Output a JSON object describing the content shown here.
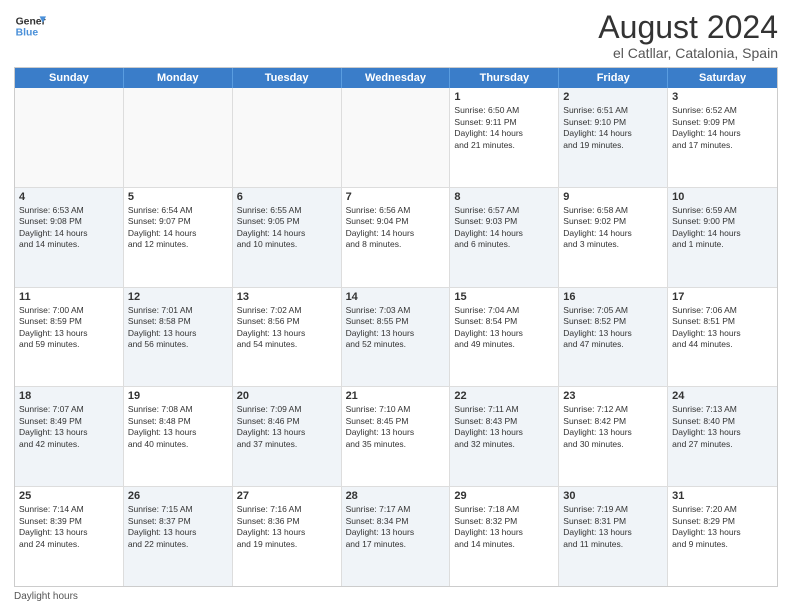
{
  "header": {
    "logo_line1": "General",
    "logo_line2": "Blue",
    "main_title": "August 2024",
    "subtitle": "el Catllar, Catalonia, Spain"
  },
  "calendar": {
    "days_of_week": [
      "Sunday",
      "Monday",
      "Tuesday",
      "Wednesday",
      "Thursday",
      "Friday",
      "Saturday"
    ],
    "weeks": [
      [
        {
          "day": "",
          "empty": true,
          "shaded": false,
          "lines": []
        },
        {
          "day": "",
          "empty": true,
          "shaded": false,
          "lines": []
        },
        {
          "day": "",
          "empty": true,
          "shaded": false,
          "lines": []
        },
        {
          "day": "",
          "empty": true,
          "shaded": false,
          "lines": []
        },
        {
          "day": "1",
          "empty": false,
          "shaded": false,
          "lines": [
            "Sunrise: 6:50 AM",
            "Sunset: 9:11 PM",
            "Daylight: 14 hours",
            "and 21 minutes."
          ]
        },
        {
          "day": "2",
          "empty": false,
          "shaded": true,
          "lines": [
            "Sunrise: 6:51 AM",
            "Sunset: 9:10 PM",
            "Daylight: 14 hours",
            "and 19 minutes."
          ]
        },
        {
          "day": "3",
          "empty": false,
          "shaded": false,
          "lines": [
            "Sunrise: 6:52 AM",
            "Sunset: 9:09 PM",
            "Daylight: 14 hours",
            "and 17 minutes."
          ]
        }
      ],
      [
        {
          "day": "4",
          "empty": false,
          "shaded": true,
          "lines": [
            "Sunrise: 6:53 AM",
            "Sunset: 9:08 PM",
            "Daylight: 14 hours",
            "and 14 minutes."
          ]
        },
        {
          "day": "5",
          "empty": false,
          "shaded": false,
          "lines": [
            "Sunrise: 6:54 AM",
            "Sunset: 9:07 PM",
            "Daylight: 14 hours",
            "and 12 minutes."
          ]
        },
        {
          "day": "6",
          "empty": false,
          "shaded": true,
          "lines": [
            "Sunrise: 6:55 AM",
            "Sunset: 9:05 PM",
            "Daylight: 14 hours",
            "and 10 minutes."
          ]
        },
        {
          "day": "7",
          "empty": false,
          "shaded": false,
          "lines": [
            "Sunrise: 6:56 AM",
            "Sunset: 9:04 PM",
            "Daylight: 14 hours",
            "and 8 minutes."
          ]
        },
        {
          "day": "8",
          "empty": false,
          "shaded": true,
          "lines": [
            "Sunrise: 6:57 AM",
            "Sunset: 9:03 PM",
            "Daylight: 14 hours",
            "and 6 minutes."
          ]
        },
        {
          "day": "9",
          "empty": false,
          "shaded": false,
          "lines": [
            "Sunrise: 6:58 AM",
            "Sunset: 9:02 PM",
            "Daylight: 14 hours",
            "and 3 minutes."
          ]
        },
        {
          "day": "10",
          "empty": false,
          "shaded": true,
          "lines": [
            "Sunrise: 6:59 AM",
            "Sunset: 9:00 PM",
            "Daylight: 14 hours",
            "and 1 minute."
          ]
        }
      ],
      [
        {
          "day": "11",
          "empty": false,
          "shaded": false,
          "lines": [
            "Sunrise: 7:00 AM",
            "Sunset: 8:59 PM",
            "Daylight: 13 hours",
            "and 59 minutes."
          ]
        },
        {
          "day": "12",
          "empty": false,
          "shaded": true,
          "lines": [
            "Sunrise: 7:01 AM",
            "Sunset: 8:58 PM",
            "Daylight: 13 hours",
            "and 56 minutes."
          ]
        },
        {
          "day": "13",
          "empty": false,
          "shaded": false,
          "lines": [
            "Sunrise: 7:02 AM",
            "Sunset: 8:56 PM",
            "Daylight: 13 hours",
            "and 54 minutes."
          ]
        },
        {
          "day": "14",
          "empty": false,
          "shaded": true,
          "lines": [
            "Sunrise: 7:03 AM",
            "Sunset: 8:55 PM",
            "Daylight: 13 hours",
            "and 52 minutes."
          ]
        },
        {
          "day": "15",
          "empty": false,
          "shaded": false,
          "lines": [
            "Sunrise: 7:04 AM",
            "Sunset: 8:54 PM",
            "Daylight: 13 hours",
            "and 49 minutes."
          ]
        },
        {
          "day": "16",
          "empty": false,
          "shaded": true,
          "lines": [
            "Sunrise: 7:05 AM",
            "Sunset: 8:52 PM",
            "Daylight: 13 hours",
            "and 47 minutes."
          ]
        },
        {
          "day": "17",
          "empty": false,
          "shaded": false,
          "lines": [
            "Sunrise: 7:06 AM",
            "Sunset: 8:51 PM",
            "Daylight: 13 hours",
            "and 44 minutes."
          ]
        }
      ],
      [
        {
          "day": "18",
          "empty": false,
          "shaded": true,
          "lines": [
            "Sunrise: 7:07 AM",
            "Sunset: 8:49 PM",
            "Daylight: 13 hours",
            "and 42 minutes."
          ]
        },
        {
          "day": "19",
          "empty": false,
          "shaded": false,
          "lines": [
            "Sunrise: 7:08 AM",
            "Sunset: 8:48 PM",
            "Daylight: 13 hours",
            "and 40 minutes."
          ]
        },
        {
          "day": "20",
          "empty": false,
          "shaded": true,
          "lines": [
            "Sunrise: 7:09 AM",
            "Sunset: 8:46 PM",
            "Daylight: 13 hours",
            "and 37 minutes."
          ]
        },
        {
          "day": "21",
          "empty": false,
          "shaded": false,
          "lines": [
            "Sunrise: 7:10 AM",
            "Sunset: 8:45 PM",
            "Daylight: 13 hours",
            "and 35 minutes."
          ]
        },
        {
          "day": "22",
          "empty": false,
          "shaded": true,
          "lines": [
            "Sunrise: 7:11 AM",
            "Sunset: 8:43 PM",
            "Daylight: 13 hours",
            "and 32 minutes."
          ]
        },
        {
          "day": "23",
          "empty": false,
          "shaded": false,
          "lines": [
            "Sunrise: 7:12 AM",
            "Sunset: 8:42 PM",
            "Daylight: 13 hours",
            "and 30 minutes."
          ]
        },
        {
          "day": "24",
          "empty": false,
          "shaded": true,
          "lines": [
            "Sunrise: 7:13 AM",
            "Sunset: 8:40 PM",
            "Daylight: 13 hours",
            "and 27 minutes."
          ]
        }
      ],
      [
        {
          "day": "25",
          "empty": false,
          "shaded": false,
          "lines": [
            "Sunrise: 7:14 AM",
            "Sunset: 8:39 PM",
            "Daylight: 13 hours",
            "and 24 minutes."
          ]
        },
        {
          "day": "26",
          "empty": false,
          "shaded": true,
          "lines": [
            "Sunrise: 7:15 AM",
            "Sunset: 8:37 PM",
            "Daylight: 13 hours",
            "and 22 minutes."
          ]
        },
        {
          "day": "27",
          "empty": false,
          "shaded": false,
          "lines": [
            "Sunrise: 7:16 AM",
            "Sunset: 8:36 PM",
            "Daylight: 13 hours",
            "and 19 minutes."
          ]
        },
        {
          "day": "28",
          "empty": false,
          "shaded": true,
          "lines": [
            "Sunrise: 7:17 AM",
            "Sunset: 8:34 PM",
            "Daylight: 13 hours",
            "and 17 minutes."
          ]
        },
        {
          "day": "29",
          "empty": false,
          "shaded": false,
          "lines": [
            "Sunrise: 7:18 AM",
            "Sunset: 8:32 PM",
            "Daylight: 13 hours",
            "and 14 minutes."
          ]
        },
        {
          "day": "30",
          "empty": false,
          "shaded": true,
          "lines": [
            "Sunrise: 7:19 AM",
            "Sunset: 8:31 PM",
            "Daylight: 13 hours",
            "and 11 minutes."
          ]
        },
        {
          "day": "31",
          "empty": false,
          "shaded": false,
          "lines": [
            "Sunrise: 7:20 AM",
            "Sunset: 8:29 PM",
            "Daylight: 13 hours",
            "and 9 minutes."
          ]
        }
      ]
    ]
  },
  "footer": {
    "daylight_label": "Daylight hours"
  }
}
